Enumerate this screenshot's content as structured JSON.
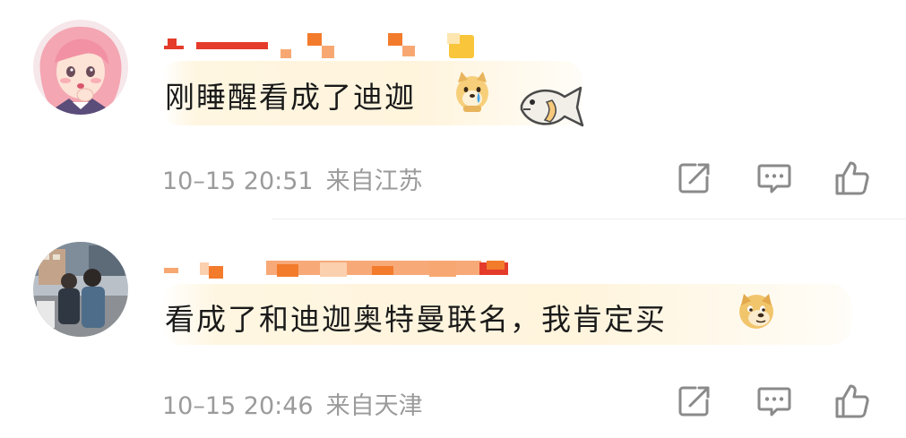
{
  "comments": [
    {
      "text": "刚睡醒看成了迪迦",
      "time": "10–15 20:51",
      "location": "来自江苏",
      "emoji": "doge-crying-icon",
      "sticker": "fish-sticker"
    },
    {
      "text": "看成了和迪迦奥特曼联名，我肯定买",
      "time": "10–15 20:46",
      "location": "来自天津",
      "emoji": "doge-icon"
    }
  ],
  "colors": {
    "text": "#1a1a1a",
    "meta": "#9b9b9b",
    "username_pixels": "#f37b2c",
    "highlight": "#fff4dc",
    "icon": "#8a8a8a"
  },
  "icons": {
    "share": "share-icon",
    "reply": "comment-icon",
    "like": "thumbs-up-icon"
  }
}
